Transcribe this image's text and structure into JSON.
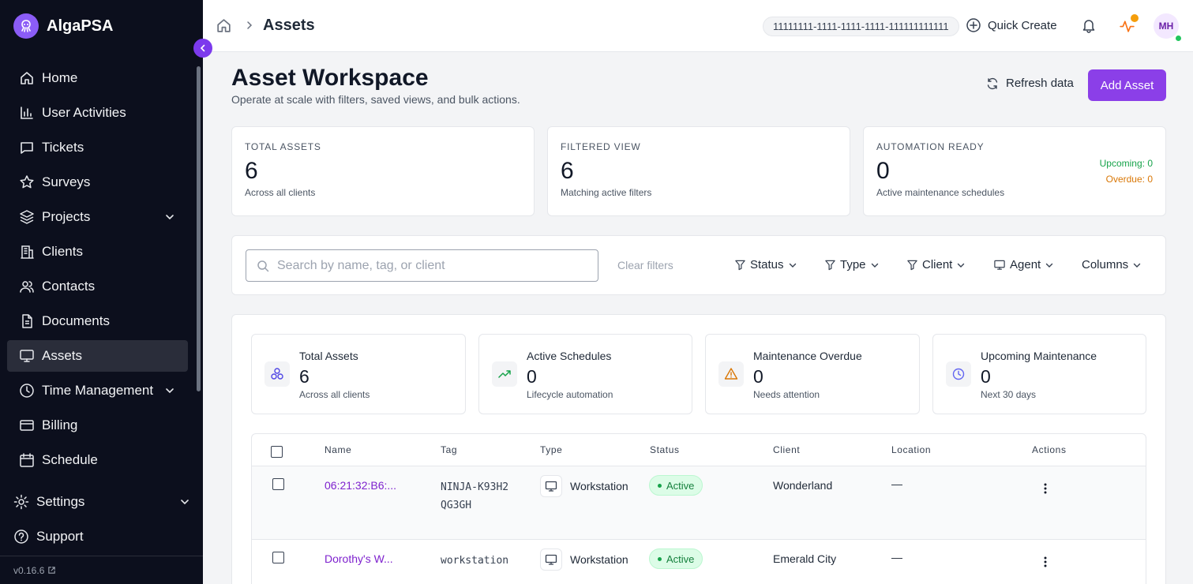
{
  "app": {
    "name": "AlgaPSA",
    "version": "v0.16.6"
  },
  "sidebar": {
    "items": [
      {
        "label": "Home"
      },
      {
        "label": "User Activities"
      },
      {
        "label": "Tickets"
      },
      {
        "label": "Surveys"
      },
      {
        "label": "Projects"
      },
      {
        "label": "Clients"
      },
      {
        "label": "Contacts"
      },
      {
        "label": "Documents"
      },
      {
        "label": "Assets"
      },
      {
        "label": "Time Management"
      },
      {
        "label": "Billing"
      },
      {
        "label": "Schedule"
      }
    ],
    "bottom": [
      {
        "label": "Settings"
      },
      {
        "label": "Support"
      }
    ],
    "active": "Assets"
  },
  "header": {
    "breadcrumb": "Assets",
    "tenant_id": "11111111-1111-1111-1111-111111111111",
    "quick_create": "Quick Create",
    "avatar_initials": "MH"
  },
  "page": {
    "title": "Asset Workspace",
    "subtitle": "Operate at scale with filters, saved views, and bulk actions.",
    "refresh_label": "Refresh data",
    "add_label": "Add Asset"
  },
  "stats": [
    {
      "label": "TOTAL ASSETS",
      "value": "6",
      "sub": "Across all clients"
    },
    {
      "label": "FILTERED VIEW",
      "value": "6",
      "sub": "Matching active filters"
    },
    {
      "label": "AUTOMATION READY",
      "value": "0",
      "sub": "Active maintenance schedules",
      "upcoming": "Upcoming: 0",
      "overdue": "Overdue: 0"
    }
  ],
  "filters": {
    "search_placeholder": "Search by name, tag, or client",
    "search_value": "",
    "clear": "Clear filters",
    "status": "Status",
    "type": "Type",
    "client": "Client",
    "agent": "Agent",
    "columns": "Columns"
  },
  "summary": [
    {
      "title": "Total Assets",
      "value": "6",
      "sub": "Across all clients",
      "icon": "assets-icon"
    },
    {
      "title": "Active Schedules",
      "value": "0",
      "sub": "Lifecycle automation",
      "icon": "trend-up-icon"
    },
    {
      "title": "Maintenance Overdue",
      "value": "0",
      "sub": "Needs attention",
      "icon": "warning-icon"
    },
    {
      "title": "Upcoming Maintenance",
      "value": "0",
      "sub": "Next 30 days",
      "icon": "clock-icon"
    }
  ],
  "table": {
    "columns": [
      "Name",
      "Tag",
      "Type",
      "Status",
      "Client",
      "Location",
      "Actions"
    ],
    "rows": [
      {
        "name": "06:21:32:B6:...",
        "tag": "NINJA-K93H2QG3GH",
        "type": "Workstation",
        "status": "Active",
        "client": "Wonderland",
        "location": "—"
      },
      {
        "name": "Dorothy's W...",
        "tag": "workstation",
        "type": "Workstation",
        "status": "Active",
        "client": "Emerald City",
        "location": "—"
      }
    ]
  },
  "colors": {
    "accent": "#8b3fe8",
    "sidebar_bg": "#0c0f1d",
    "active_green": "#16a34a",
    "overdue_orange": "#d97706"
  }
}
